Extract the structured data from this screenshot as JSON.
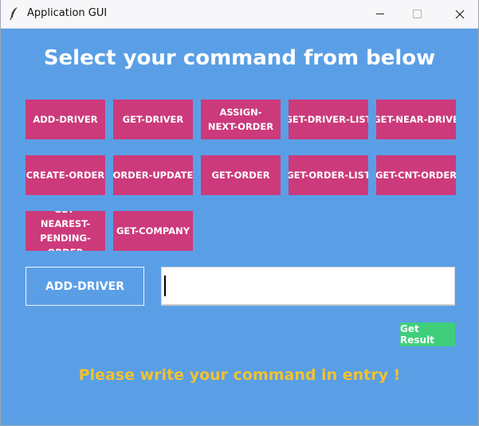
{
  "window": {
    "title": "Application GUI",
    "icon": "feather-icon",
    "controls": [
      "minimize-icon",
      "maximize-icon",
      "close-icon"
    ]
  },
  "heading": "Select your command from below",
  "commands": [
    [
      "ADD-DRIVER",
      "GET-DRIVER",
      "ASSIGN-NEXT-ORDER",
      "GET-DRIVER-LIST",
      "GET-NEAR-DRIVE"
    ],
    [
      "CREATE-ORDER",
      "ORDER-UPDATE",
      "GET-ORDER",
      "GET-ORDER-LIST",
      "GET-CNT-ORDER"
    ],
    [
      "GET-NEAREST-PENDING-ORDER",
      "GET-COMPANY"
    ]
  ],
  "selected_command": "ADD-DRIVER",
  "entry": {
    "value": "",
    "placeholder": ""
  },
  "get_result_label": "Get Result",
  "status": "Please write your command in entry !",
  "colors": {
    "background": "#5a9fe6",
    "command_button": "#cc3a7b",
    "get_result_button": "#3fcf7c",
    "status_text": "#f2c230"
  }
}
